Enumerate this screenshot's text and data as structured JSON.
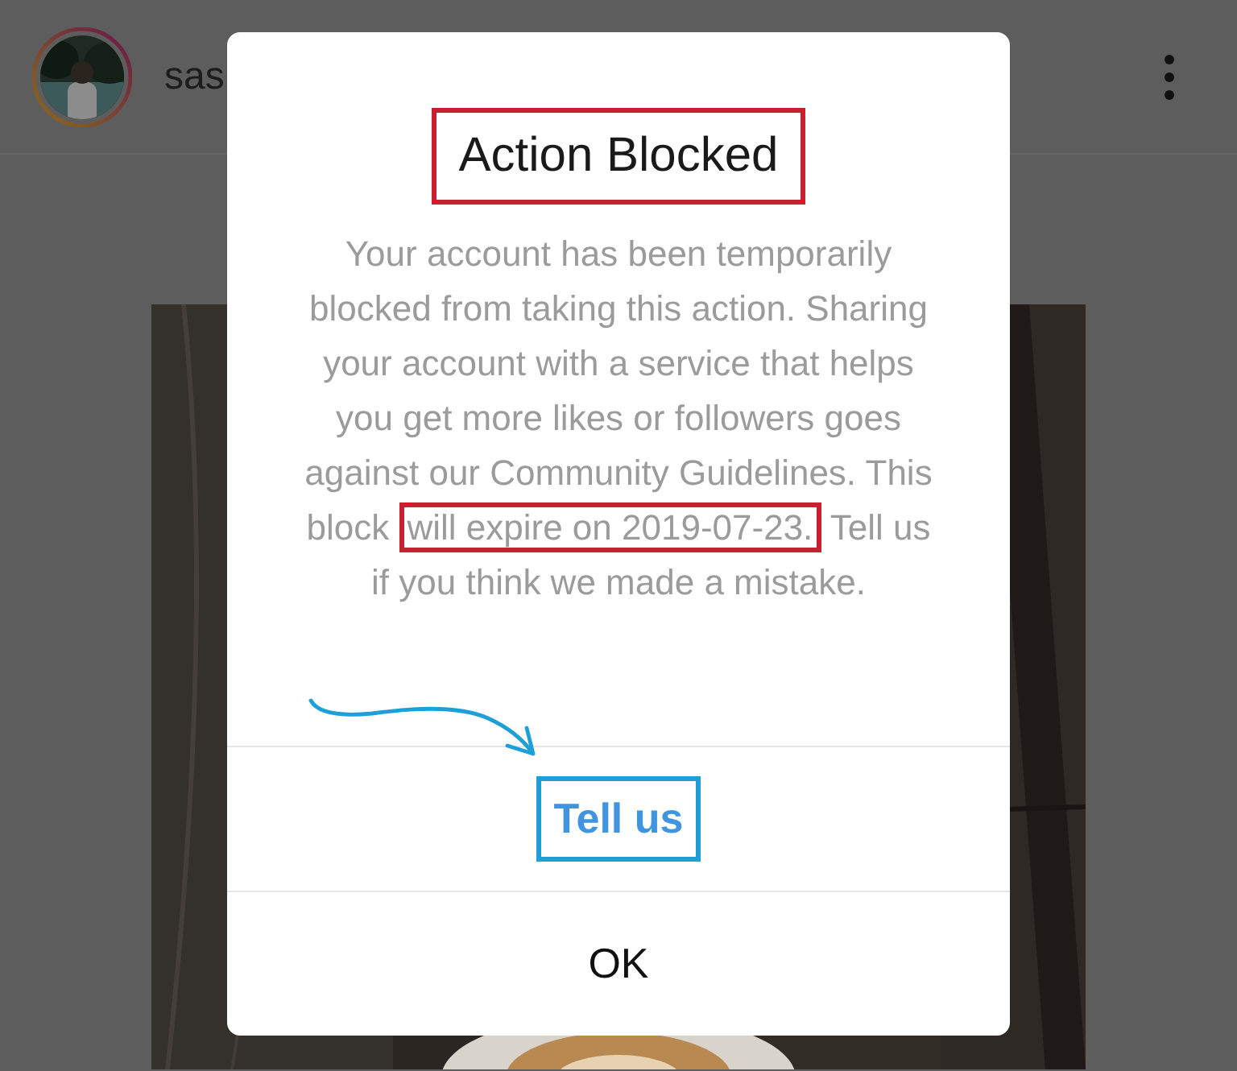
{
  "profile": {
    "username": "sas"
  },
  "dialog": {
    "title": {
      "text": "Action Blocked",
      "annotated": true
    },
    "message": {
      "before": "Your account has been temporarily blocked from taking this action. Sharing your account with a service that helps you get more likes or followers goes against our Community Guidelines. This block",
      "highlight": "will expire on 2019-07-23.",
      "after": "Tell us if you think we made a mistake."
    },
    "buttons": [
      {
        "label": "Tell us",
        "kind": "link",
        "annotated": true
      },
      {
        "label": "OK",
        "kind": "plain",
        "annotated": false
      }
    ]
  }
}
